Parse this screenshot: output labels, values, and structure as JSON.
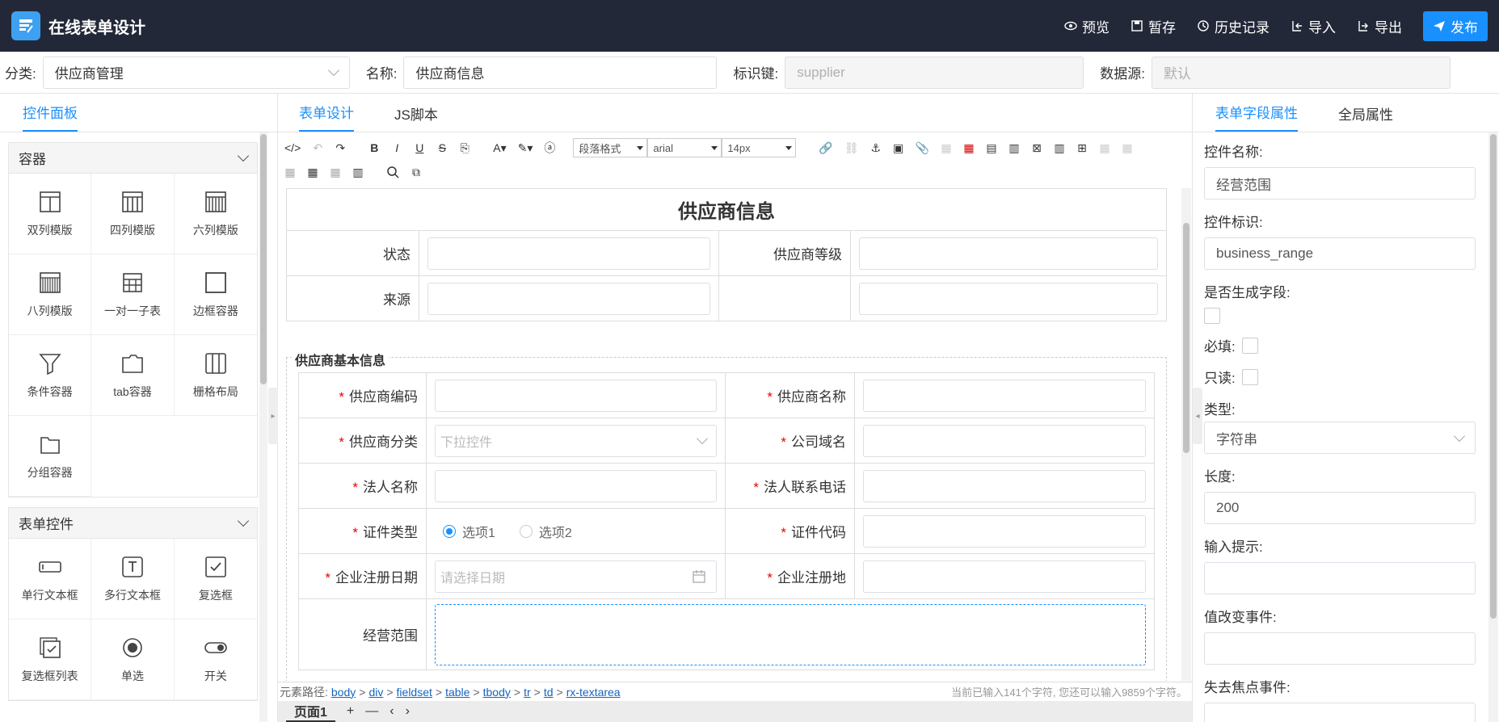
{
  "header": {
    "title": "在线表单设计",
    "actions": [
      {
        "label": "预览",
        "icon": "eye-icon"
      },
      {
        "label": "暂存",
        "icon": "save-icon"
      },
      {
        "label": "历史记录",
        "icon": "history-icon"
      },
      {
        "label": "导入",
        "icon": "import-icon"
      },
      {
        "label": "导出",
        "icon": "export-icon"
      }
    ],
    "publish_label": "发布"
  },
  "meta": {
    "category_label": "分类:",
    "category_value": "供应商管理",
    "name_label": "名称:",
    "name_value": "供应商信息",
    "key_label": "标识键:",
    "key_value": "supplier",
    "datasource_label": "数据源:",
    "datasource_value": "默认"
  },
  "left_panel": {
    "tab": "控件面板",
    "groups": [
      {
        "title": "容器",
        "items": [
          {
            "label": "双列模版",
            "icon": "two-column-icon"
          },
          {
            "label": "四列模版",
            "icon": "four-column-icon"
          },
          {
            "label": "六列模版",
            "icon": "six-column-icon"
          },
          {
            "label": "八列模版",
            "icon": "eight-column-icon"
          },
          {
            "label": "一对一子表",
            "icon": "subtable-icon"
          },
          {
            "label": "边框容器",
            "icon": "border-container-icon"
          },
          {
            "label": "条件容器",
            "icon": "filter-icon"
          },
          {
            "label": "tab容器",
            "icon": "tab-container-icon"
          },
          {
            "label": "栅格布局",
            "icon": "grid-layout-icon"
          },
          {
            "label": "分组容器",
            "icon": "folder-icon"
          }
        ]
      },
      {
        "title": "表单控件",
        "items": [
          {
            "label": "单行文本框",
            "icon": "single-line-input-icon"
          },
          {
            "label": "多行文本框",
            "icon": "textarea-icon"
          },
          {
            "label": "复选框",
            "icon": "checkbox-icon"
          },
          {
            "label": "复选框列表",
            "icon": "checkbox-list-icon"
          },
          {
            "label": "单选",
            "icon": "radio-icon"
          },
          {
            "label": "开关",
            "icon": "switch-icon"
          }
        ]
      }
    ]
  },
  "center": {
    "tabs": [
      "表单设计",
      "JS脚本"
    ],
    "toolbar": {
      "paragraph_format": "段落格式",
      "font_family": "arial",
      "font_size": "14px"
    },
    "form": {
      "title": "供应商信息",
      "top_rows": [
        {
          "label1": "状态",
          "label2": "供应商等级"
        },
        {
          "label1": "来源",
          "label2": ""
        }
      ],
      "fieldset_title": "供应商基本信息",
      "rows": [
        {
          "label1": "供应商编码",
          "req1": "*",
          "label2": "供应商名称",
          "req2": "*"
        },
        {
          "label1": "供应商分类",
          "req1": "*",
          "placeholder1": "下拉控件",
          "label2": "公司域名",
          "req2": "*"
        },
        {
          "label1": "法人名称",
          "req1": "*",
          "label2": "法人联系电话",
          "req2": "*"
        },
        {
          "label1": "证件类型",
          "req1": "*",
          "option1": "选项1",
          "option2": "选项2",
          "label2": "证件代码",
          "req2": "*"
        },
        {
          "label1": "企业注册日期",
          "req1": "*",
          "placeholder1": "请选择日期",
          "label2": "企业注册地",
          "req2": "*"
        },
        {
          "label1": "经营范围"
        }
      ]
    },
    "status": {
      "path_label": "元素路径:",
      "path": [
        "body",
        "div",
        "fieldset",
        "table",
        "tbody",
        "tr",
        "td",
        "rx-textarea"
      ],
      "counter": "当前已输入141个字符, 您还可以输入9859个字符。"
    },
    "pages": {
      "tab": "页面1"
    }
  },
  "right_panel": {
    "tabs": [
      "表单字段属性",
      "全局属性"
    ],
    "props": {
      "name_label": "控件名称:",
      "name_value": "经营范围",
      "id_label": "控件标识:",
      "id_value": "business_range",
      "gen_label": "是否生成字段:",
      "required_label": "必填:",
      "readonly_label": "只读:",
      "type_label": "类型:",
      "type_value": "字符串",
      "length_label": "长度:",
      "length_value": "200",
      "hint_label": "输入提示:",
      "change_label": "值改变事件:",
      "blur_label": "失去焦点事件:"
    }
  },
  "colors": {
    "header_bg": "#232839",
    "accent": "#1890ff",
    "required": "#e00000"
  }
}
